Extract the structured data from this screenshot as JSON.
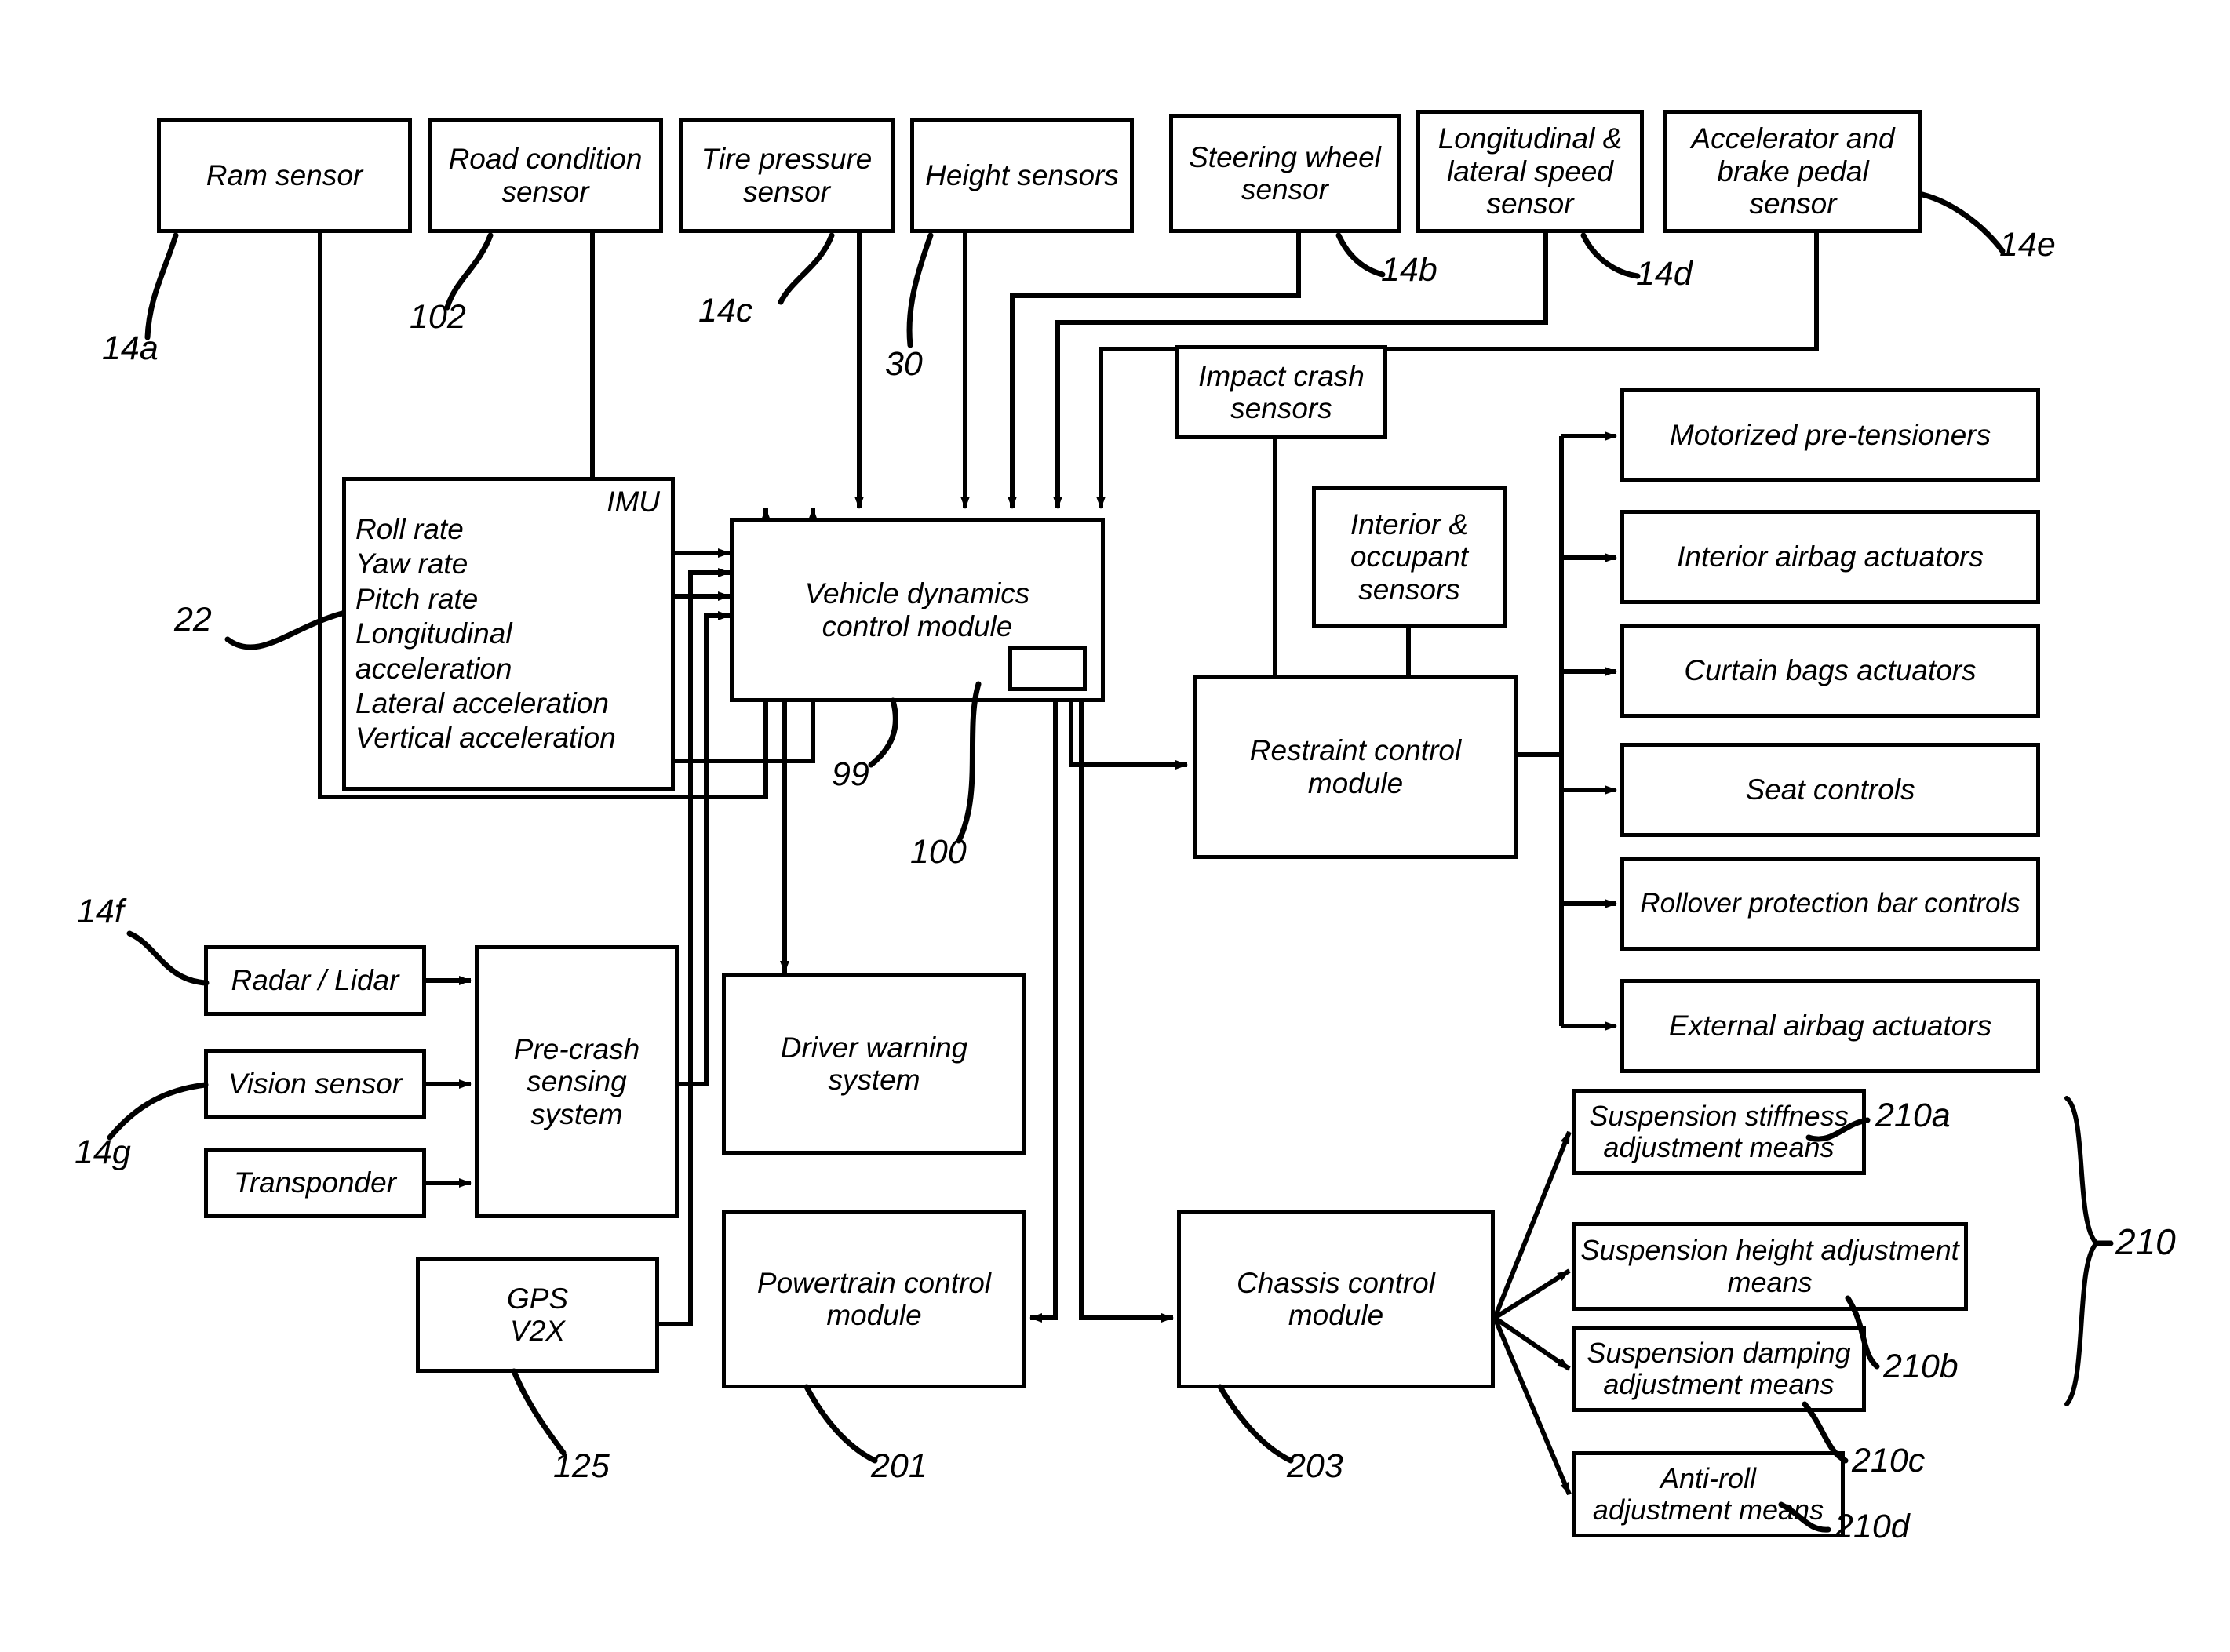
{
  "diagram": {
    "title": "Vehicle dynamics and safety control block diagram",
    "sensors_top": [
      {
        "label": "Ram sensor",
        "ref": "14a"
      },
      {
        "label": "Road condition\nsensor",
        "ref": "102"
      },
      {
        "label": "Tire pressure\nsensor",
        "ref": "14c"
      },
      {
        "label": "Height sensors",
        "ref": "30"
      },
      {
        "label": "Steering wheel\nsensor",
        "ref": "14b"
      },
      {
        "label": "Longitudinal &\nlateral speed\nsensor",
        "ref": "14d"
      },
      {
        "label": "Accelerator and\nbrake pedal\nsensor",
        "ref": "14e"
      }
    ],
    "imu": {
      "title": "IMU",
      "ref": "22",
      "items": [
        "Roll rate",
        "Yaw rate",
        "Pitch rate",
        "Longitudinal acceleration",
        "Lateral acceleration",
        "Vertical acceleration"
      ]
    },
    "vehicle_dynamics": {
      "label": "Vehicle dynamics\ncontrol module",
      "ref_output": "99",
      "ref_inner": "100"
    },
    "crash_sensors": {
      "label": "Impact crash\nsensors"
    },
    "occupant_sensors": {
      "label": "Interior &\noccupant\nsensors"
    },
    "restraint_control": {
      "label": "Restraint control\nmodule"
    },
    "restraint_actuators": [
      "Motorized pre-tensioners",
      "Interior airbag actuators",
      "Curtain bags actuators",
      "Seat controls",
      "Rollover protection bar controls",
      "External airbag actuators"
    ],
    "precrash_inputs": [
      {
        "label": "Radar / Lidar",
        "ref": "14f"
      },
      {
        "label": "Vision sensor",
        "ref": "14g"
      },
      {
        "label": "Transponder",
        "ref": ""
      }
    ],
    "precrash_system": {
      "label": "Pre-crash\nsensing\nsystem"
    },
    "gps": {
      "label": "GPS\nV2X",
      "ref": "125"
    },
    "driver_warning": {
      "label": "Driver warning\nsystem"
    },
    "powertrain": {
      "label": "Powertrain control\nmodule",
      "ref": "201"
    },
    "chassis": {
      "label": "Chassis control\nmodule",
      "ref": "203"
    },
    "suspension_group": {
      "ref": "210",
      "items": [
        {
          "label": "Suspension stiffness\nadjustment means",
          "ref": "210a"
        },
        {
          "label": "Suspension height adjustment\nmeans",
          "ref": "210b"
        },
        {
          "label": "Suspension damping\nadjustment means",
          "ref": "210c"
        },
        {
          "label": "Anti-roll\nadjustment means",
          "ref": "210d"
        }
      ]
    },
    "colors": {
      "stroke": "#000000",
      "background": "#ffffff"
    }
  }
}
